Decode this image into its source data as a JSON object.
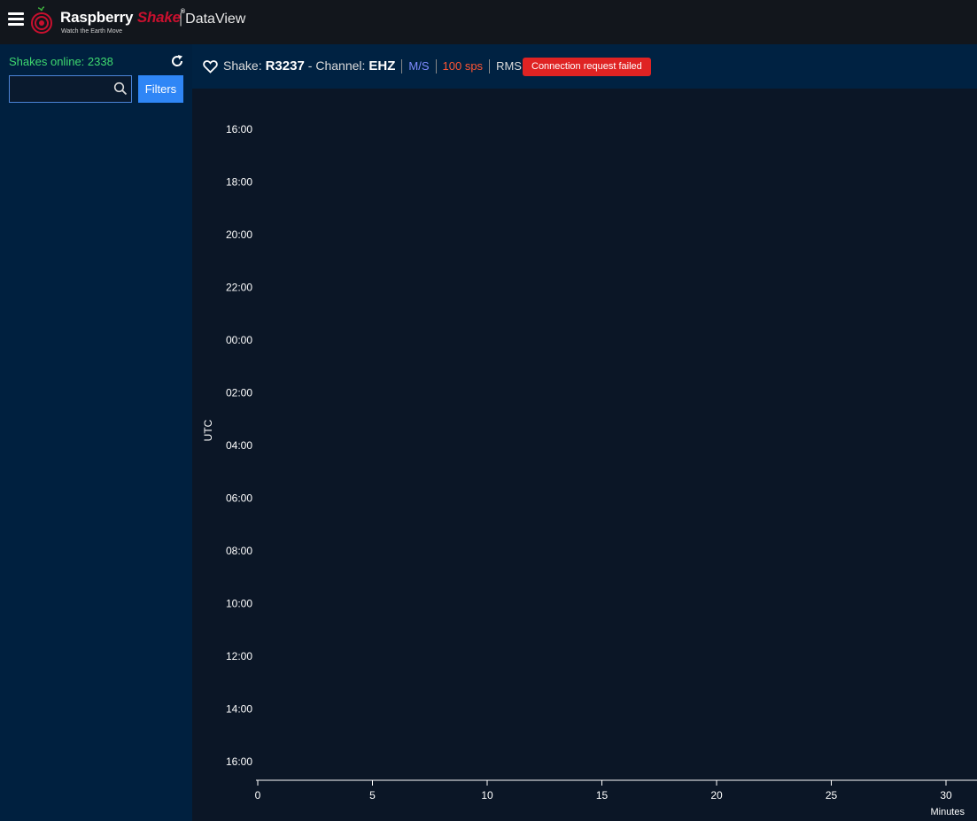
{
  "header": {
    "brand_part1": "Raspberry",
    "brand_part2": "Shake",
    "brand_mark": "®",
    "tagline": "Watch the Earth Move",
    "separator": "|",
    "app_name": "DataView"
  },
  "sidebar": {
    "online_text": "Shakes online: 2338",
    "search_value": "",
    "search_placeholder": "",
    "filters_label": "Filters"
  },
  "station_bar": {
    "shake_label": "Shake:",
    "shake_id": "R3237",
    "channel_label": "- Channel:",
    "channel_id": "EHZ",
    "units": "M/S",
    "sps": "100 sps",
    "mode": "RMS",
    "error": "Connection request failed"
  },
  "colors": {
    "online_text": "#3ed86f",
    "units": "#7f8cff",
    "sps": "#ff5533",
    "error_bg": "#df2323",
    "filters_bg": "#2f86f6",
    "brand_accent": "#c8102e"
  },
  "icons": {
    "menu": "hamburger-icon",
    "logo": "raspberry-shake-logo-icon",
    "refresh": "refresh-icon",
    "search": "search-icon",
    "favorite": "heart-icon"
  },
  "chart_data": {
    "type": "line",
    "ylabel": "UTC",
    "xlabel": "Minutes",
    "xlim": [
      0,
      30
    ],
    "x_ticks": [
      0,
      5,
      10,
      15,
      20,
      25,
      30
    ],
    "y_ticks": [
      "16:00",
      "18:00",
      "20:00",
      "22:00",
      "00:00",
      "02:00",
      "04:00",
      "06:00",
      "08:00",
      "10:00",
      "12:00",
      "14:00",
      "16:00"
    ],
    "series": []
  }
}
